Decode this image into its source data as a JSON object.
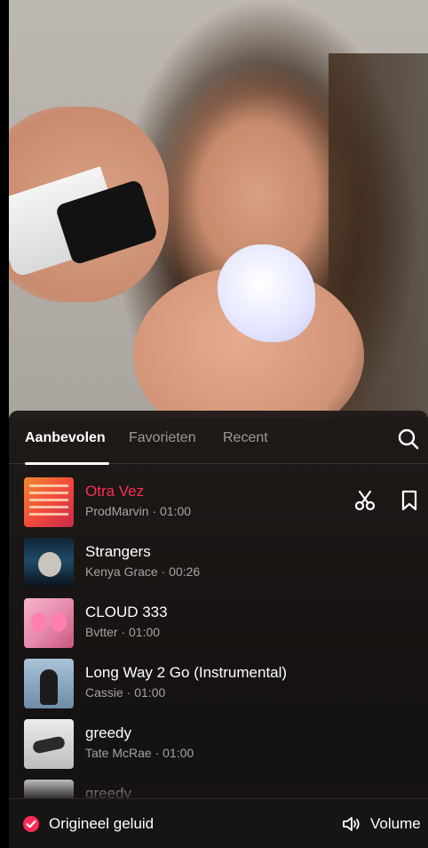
{
  "tabs": [
    {
      "label": "Aanbevolen",
      "active": true
    },
    {
      "label": "Favorieten",
      "active": false
    },
    {
      "label": "Recent",
      "active": false
    }
  ],
  "icons": {
    "search": "search-icon",
    "trim": "scissors-icon",
    "favorite": "bookmark-icon",
    "volume": "speaker-icon",
    "selected": "check-circle-icon"
  },
  "tracks": [
    {
      "title": "Otra Vez",
      "meta": "ProdMarvin · 01:00",
      "playing": true
    },
    {
      "title": "Strangers",
      "meta": "Kenya Grace · 00:26",
      "playing": false
    },
    {
      "title": "CLOUD 333",
      "meta": "Bvtter · 01:00",
      "playing": false
    },
    {
      "title": "Long Way 2 Go (Instrumental)",
      "meta": "Cassie · 01:00",
      "playing": false
    },
    {
      "title": "greedy",
      "meta": "Tate McRae · 01:00",
      "playing": false
    },
    {
      "title": "greedy",
      "meta": "",
      "playing": false
    }
  ],
  "footer": {
    "original_sound_label": "Origineel geluid",
    "original_sound_checked": true,
    "volume_label": "Volume"
  },
  "colors": {
    "accent": "#fe2c55",
    "sheet_bg": "#1c1816",
    "text_secondary": "rgba(255,255,255,0.6)"
  }
}
